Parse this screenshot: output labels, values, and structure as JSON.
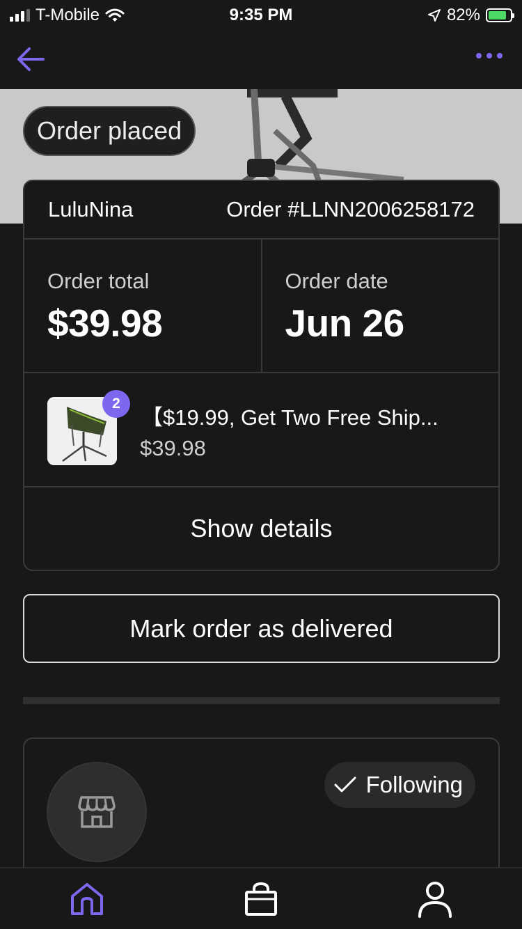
{
  "status_bar": {
    "carrier": "T-Mobile",
    "time": "9:35 PM",
    "battery": "82%"
  },
  "hero": {
    "status_label": "Order placed"
  },
  "order": {
    "shop_name": "LuluNina",
    "order_number": "Order #LLNN2006258172",
    "total_label": "Order total",
    "total_value": "$39.98",
    "date_label": "Order date",
    "date_value": "Jun 26",
    "item": {
      "quantity": "2",
      "title": "【$19.99, Get Two Free Ship...",
      "price": "$39.98"
    },
    "details_label": "Show details"
  },
  "actions": {
    "mark_delivered_label": "Mark order as delivered"
  },
  "shop": {
    "follow_label": "Following"
  },
  "colors": {
    "accent": "#7b68ee",
    "background": "#181818",
    "border": "#3a3a3a",
    "battery_fill": "#4cd964"
  },
  "icons": {
    "back": "arrow-left-icon",
    "more": "more-dots-icon",
    "store": "store-icon",
    "check": "check-icon",
    "home": "home-icon",
    "bag": "shopping-bag-icon",
    "profile": "person-icon"
  }
}
